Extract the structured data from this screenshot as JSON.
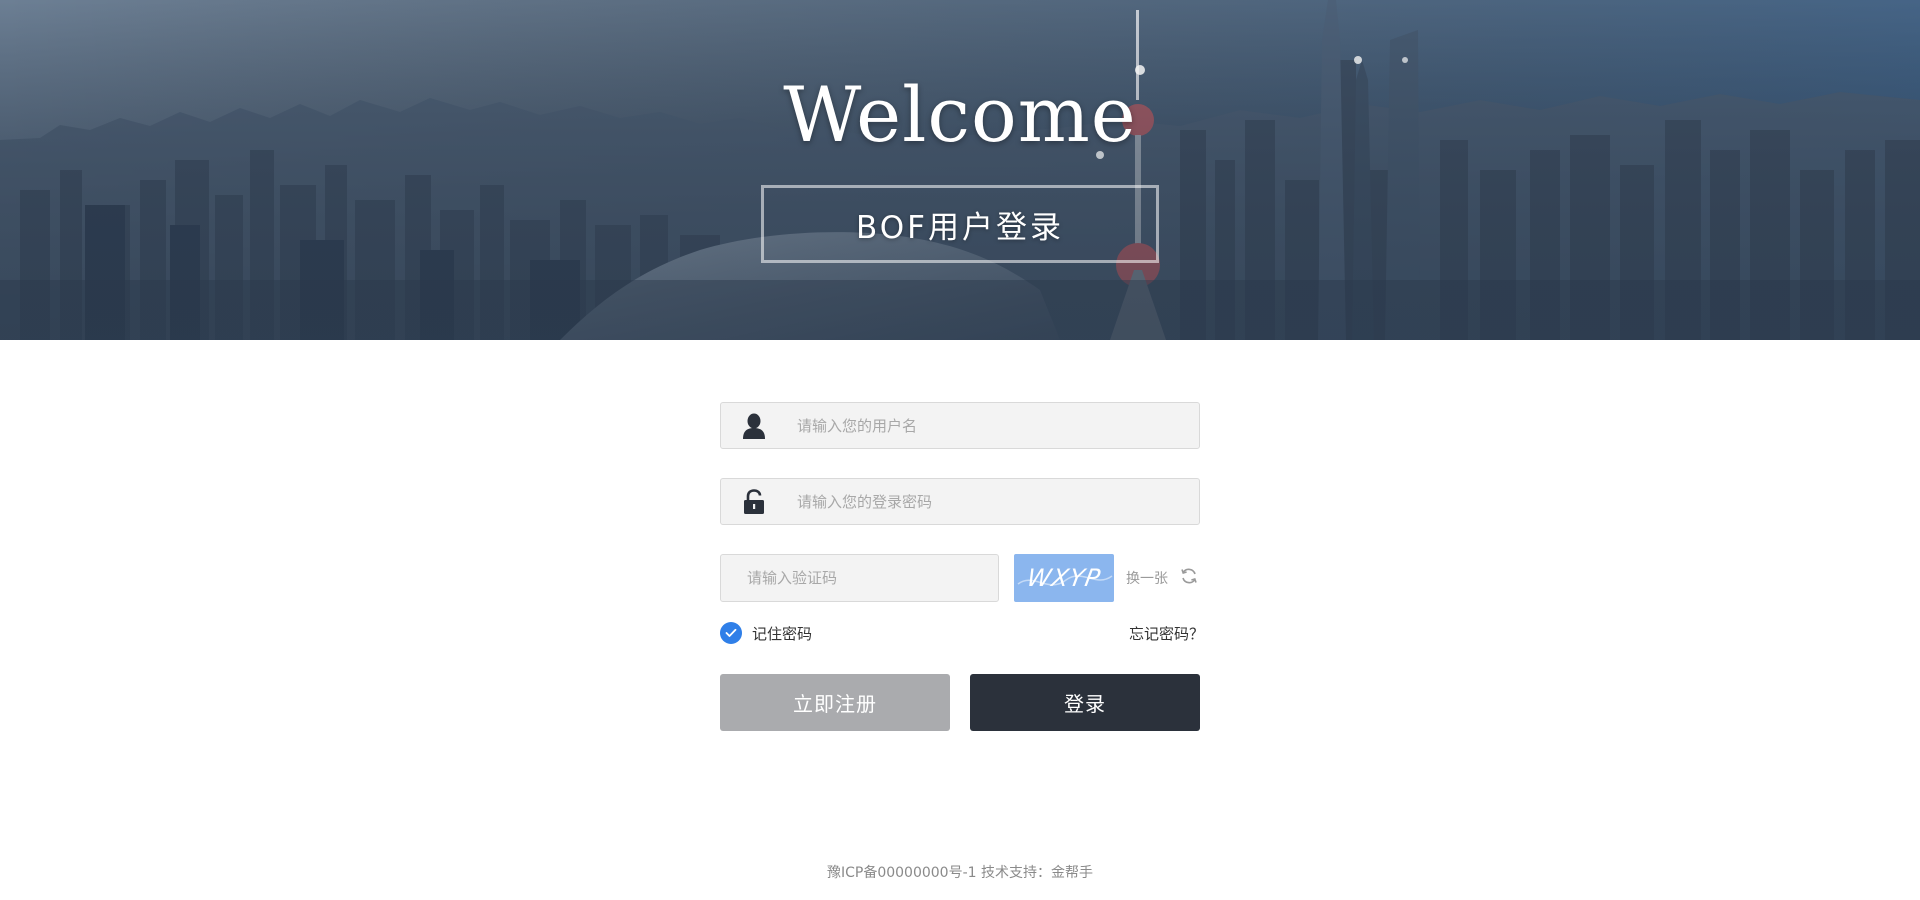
{
  "hero": {
    "title": "Welcome",
    "subtitle": "BOF用户登录"
  },
  "form": {
    "username": {
      "placeholder": "请输入您的用户名",
      "value": "",
      "icon": "user-icon"
    },
    "password": {
      "placeholder": "请输入您的登录密码",
      "value": "",
      "icon": "lock-icon"
    },
    "captcha": {
      "placeholder": "请输入验证码",
      "value": "",
      "image_text": "WXYP",
      "refresh_label": "换一张",
      "refresh_icon": "refresh-icon"
    },
    "remember": {
      "label": "记住密码",
      "checked": true
    },
    "forgot_label": "忘记密码？",
    "register_label": "立即注册",
    "login_label": "登录"
  },
  "footer": {
    "text": "豫ICP备00000000号-1 技术支持：金帮手"
  },
  "colors": {
    "checkbox": "#2f7fe8",
    "captcha_bg": "#8bb6ee",
    "register_bg": "#aaabae",
    "login_bg": "#2b313b"
  }
}
